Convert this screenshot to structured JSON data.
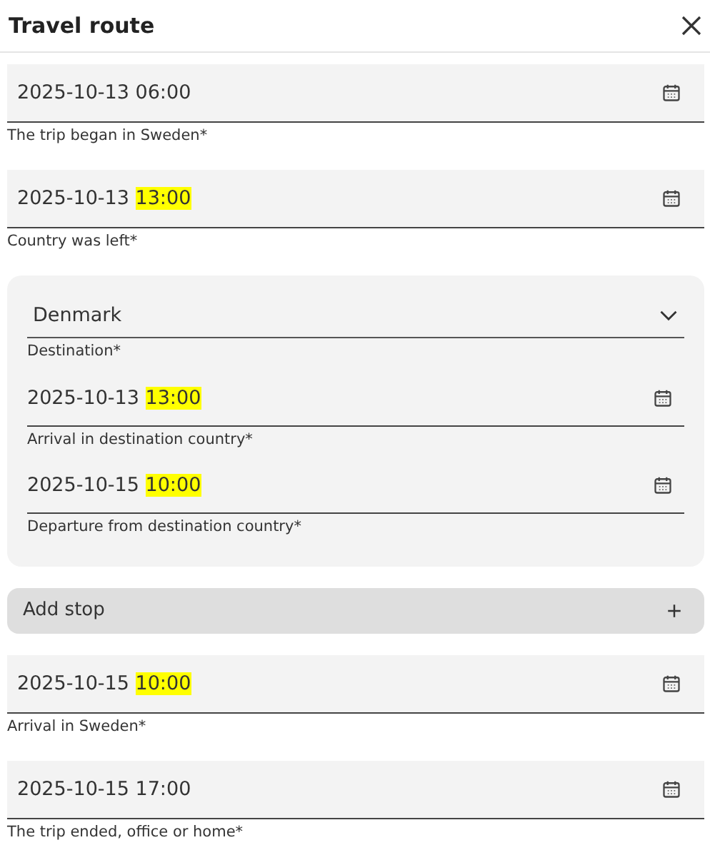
{
  "dialog": {
    "title": "Travel route"
  },
  "sections": [
    {
      "kind": "datetime",
      "date": "2025-10-13",
      "time": "06:00",
      "highlighted": false,
      "label": "The trip began in Sweden*"
    },
    {
      "kind": "datetime",
      "date": "2025-10-13",
      "time": "13:00",
      "highlighted": true,
      "label": "Country was left*"
    },
    {
      "kind": "destination",
      "country": "Denmark",
      "label": "Destination*",
      "fields": [
        {
          "date": "2025-10-13",
          "time": "13:00",
          "highlighted": true,
          "label": "Arrival in destination country*"
        },
        {
          "date": "2025-10-15",
          "time": "10:00",
          "highlighted": true,
          "label": "Departure from destination country*"
        }
      ]
    },
    {
      "kind": "add",
      "label": "Add stop"
    },
    {
      "kind": "datetime",
      "date": "2025-10-15",
      "time": "10:00",
      "highlighted": true,
      "label": "Arrival in Sweden*"
    },
    {
      "kind": "datetime",
      "date": "2025-10-15",
      "time": "17:00",
      "highlighted": false,
      "label": "The trip ended, office or home*"
    }
  ]
}
